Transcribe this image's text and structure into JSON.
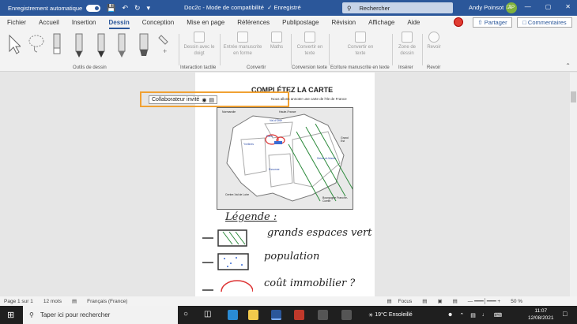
{
  "titlebar": {
    "autosave_label": "Enregistrement automatique",
    "doc_title": "Doc2c  -  Mode de compatibilité",
    "saved_status": "Enregistré",
    "search_placeholder": "Rechercher",
    "user_name": "Andy Poinsot",
    "user_initials": "AP"
  },
  "menu": {
    "tabs": [
      "Fichier",
      "Accueil",
      "Insertion",
      "Dessin",
      "Conception",
      "Mise en page",
      "Références",
      "Publipostage",
      "Révision",
      "Affichage",
      "Aide"
    ],
    "active": "Dessin",
    "share_label": "Partager",
    "comments_label": "Commentaires"
  },
  "ribbon": {
    "groups": {
      "drawing_tools": "Outils de dessin",
      "touch": "Interaction tactile",
      "convert": "Convertir",
      "text_conversion": "Conversion texte",
      "handwriting": "Ecriture manuscrite en texte",
      "insert": "Insérer",
      "replay": "Revoir"
    },
    "buttons": {
      "draw_finger": "Dessin avec le doigt",
      "ink_to_shape": "Entrée manuscrite en forme",
      "math": "Maths",
      "convert_text": "Convertir en texte",
      "convert_text2": "Convertir en texte",
      "drawing_zone": "Zone de dessin",
      "replay": "Revoir"
    }
  },
  "document": {
    "title": "COMPLÉTEZ LA CARTE",
    "collab_label": "Collaborateur invité",
    "caption": "Nous allons annoter une carte de l'Ile de France",
    "legend_heading": "Légende :",
    "legend_items": [
      "grands espaces vert",
      "population",
      "coût immobilier ?"
    ],
    "map": {
      "labels": [
        "Normandie",
        "Haute-France",
        "Val-d'Oise",
        "Yvelines",
        "Paris",
        "Seine-et-Marne",
        "Essonne",
        "Centre-Val de Loire",
        "Bourgogne Franche-Comté",
        "Grand Est"
      ]
    }
  },
  "status": {
    "page": "Page 1 sur 1",
    "words": "12 mots",
    "lang": "Français (France)",
    "focus": "Focus",
    "zoom": "50 %"
  },
  "taskbar": {
    "search_placeholder": "Taper ici pour rechercher",
    "weather": "19°C  Ensoleillé",
    "time": "11:07",
    "date": "12/08/2021"
  }
}
